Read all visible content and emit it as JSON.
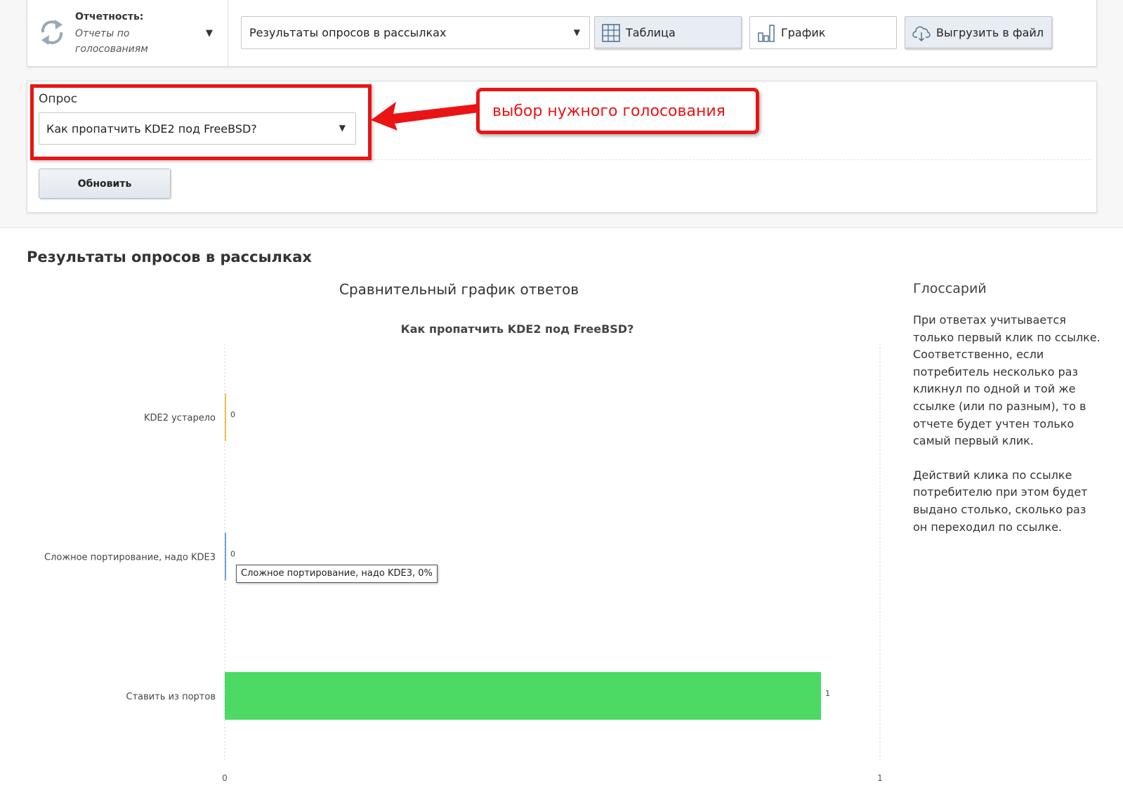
{
  "toolbar": {
    "reports_heading": "Отчетность:",
    "reports_sub": "Отчеты по голосованиям",
    "report_select_value": "Результаты опросов в рассылках",
    "table_label": "Таблица",
    "chart_label": "График",
    "export_label": "Выгрузить в файл"
  },
  "filter": {
    "poll_label": "Опрос",
    "poll_value": "Как пропатчить KDE2 под FreeBSD?",
    "refresh_label": "Обновить"
  },
  "annotation": {
    "text": "выбор нужного голосования",
    "color": "#ea1414"
  },
  "section_title": "Результаты опросов в рассылках",
  "chart_heading": "Сравнительный график ответов",
  "chart_data": {
    "type": "bar",
    "orientation": "horizontal",
    "title": "Как пропатчить KDE2 под FreeBSD?",
    "categories": [
      "KDE2 устарело",
      "Сложное портирование, надо KDE3",
      "Ставить из портов"
    ],
    "values": [
      0,
      0,
      1
    ],
    "value_labels": [
      "0",
      "0",
      "1"
    ],
    "colors": [
      "#f0c040",
      "#6aa0e0",
      "#4cd964"
    ],
    "xlim": [
      0,
      1
    ],
    "x_ticks": [
      "0",
      "1"
    ],
    "grid": true
  },
  "tooltip": {
    "text": "Сложное портирование, надо KDE3, 0%"
  },
  "glossary": {
    "title": "Глоссарий",
    "p1": "При ответах учитывается только первый клик по ссылке. Соответственно, если потребитель несколько раз кликнул по одной и той же ссылке (или по разным), то в отчете будет учтен только самый первый клик.",
    "p2": "Действий клика по ссылке потребителю при этом будет выдано столько, сколько раз он переходил по ссылке."
  }
}
